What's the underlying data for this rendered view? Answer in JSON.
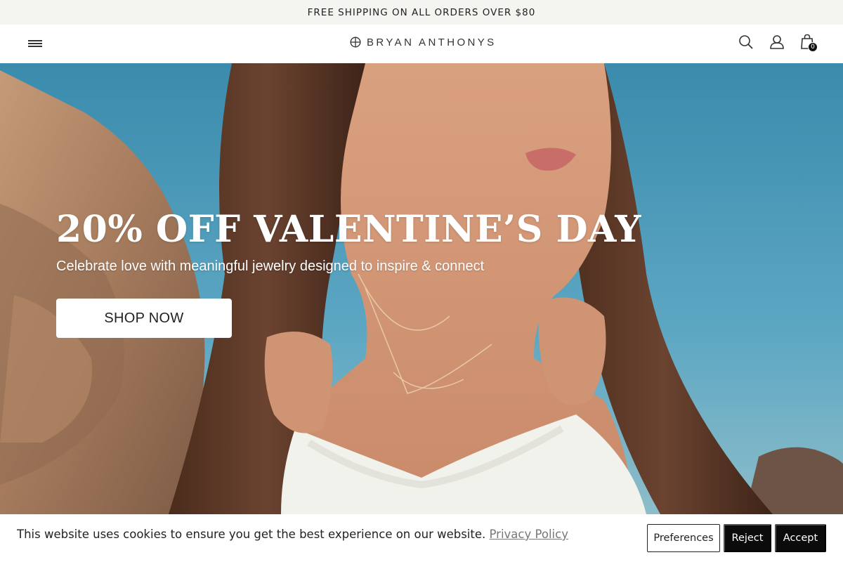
{
  "announcement": {
    "text": "FREE SHIPPING ON ALL ORDERS OVER $80"
  },
  "header": {
    "menu_icon": "hamburger-menu-icon",
    "logo_text": "BRYAN ANTHONYS",
    "logo_icon": "globe-icon",
    "icons": {
      "search": "search-icon",
      "account": "user-icon",
      "cart": "shopping-bag-icon"
    },
    "cart_count": "0"
  },
  "hero": {
    "title": "20% OFF VALENTINE’S DAY",
    "subtitle": "Celebrate love with meaningful jewelry designed to inspire & connect",
    "cta_label": "SHOP NOW"
  },
  "cookie_banner": {
    "message": "This website uses cookies to ensure you get the best experience on our website.",
    "link_label": "Privacy Policy",
    "preferences_label": "Preferences",
    "reject_label": "Reject",
    "accept_label": "Accept"
  },
  "colors": {
    "announcement_bg": "#f4f4f1",
    "button_dark": "#0b0b0b",
    "hero_sky": "#4a97b7"
  }
}
